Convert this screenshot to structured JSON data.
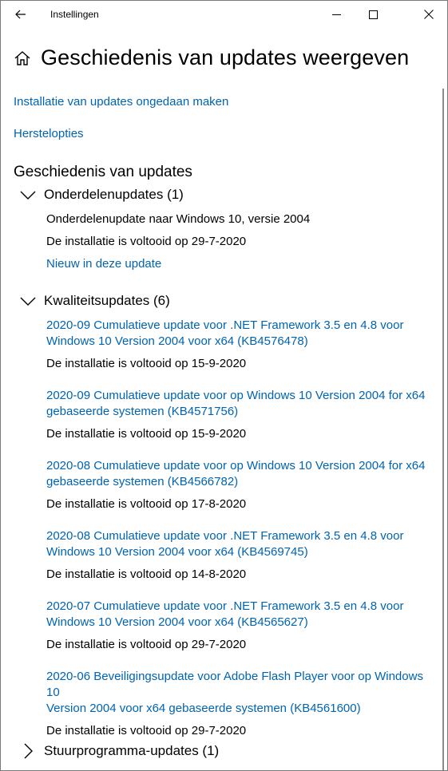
{
  "window": {
    "title": "Instellingen"
  },
  "page": {
    "title": "Geschiedenis van updates weergeven"
  },
  "links": {
    "uninstall": "Installatie van updates ongedaan maken",
    "recovery": "Herstelopties"
  },
  "history": {
    "title": "Geschiedenis van updates",
    "groups": [
      {
        "title": "Onderdelenupdates (1)",
        "name": "Onderdelenupdate naar Windows 10, versie 2004",
        "status": "De installatie is voltooid op 29-7-2020",
        "link": "Nieuw in deze update"
      },
      {
        "title": "Kwaliteitsupdates (6)",
        "items": [
          {
            "line1": "2020-09 Cumulatieve update voor .NET Framework 3.5 en 4.8 voor",
            "line2": "Windows 10 Version 2004 voor x64 (KB4576478)",
            "status": "De installatie is voltooid op 15-9-2020"
          },
          {
            "line1": "2020-09 Cumulatieve update voor op Windows 10 Version 2004 for x64",
            "line2": "gebaseerde systemen (KB4571756)",
            "status": "De installatie is voltooid op 15-9-2020"
          },
          {
            "line1": "2020-08 Cumulatieve update voor op Windows 10 Version 2004 for x64",
            "line2": "gebaseerde systemen (KB4566782)",
            "status": "De installatie is voltooid op 17-8-2020"
          },
          {
            "line1": "2020-08 Cumulatieve update voor .NET Framework 3.5 en 4.8 voor",
            "line2": "Windows 10 Version 2004 voor x64 (KB4569745)",
            "status": "De installatie is voltooid op 14-8-2020"
          },
          {
            "line1": "2020-07 Cumulatieve update voor .NET Framework 3.5 en 4.8 voor",
            "line2": "Windows 10 Version 2004 voor x64 (KB4565627)",
            "status": "De installatie is voltooid op 29-7-2020"
          },
          {
            "line1": "2020-06 Beveiligingsupdate voor Adobe Flash Player voor op Windows 10",
            "line2": "Version 2004 voor x64 gebaseerde systemen (KB4561600)",
            "status": "De installatie is voltooid op 29-7-2020"
          }
        ]
      },
      {
        "title": "Stuurprogramma-updates (1)"
      }
    ]
  }
}
